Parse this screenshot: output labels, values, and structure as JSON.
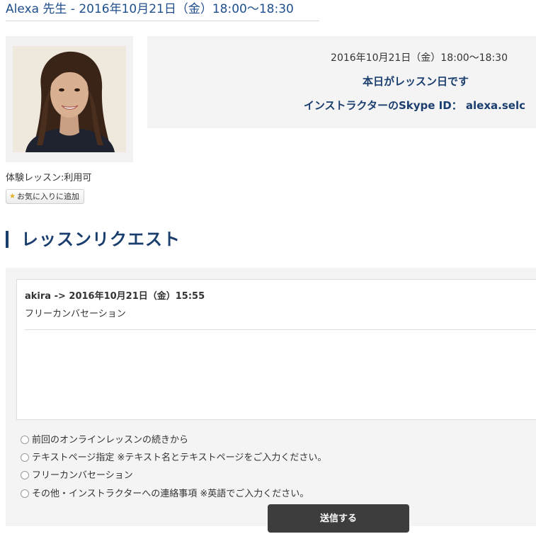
{
  "header": {
    "title": "Alexa 先生 - 2016年10月21日（金）18:00〜18:30"
  },
  "instructor": {
    "photo_alt": "instructor-photo",
    "trial_text": "体験レッスン:利用可",
    "favorite_label": "お気に入りに追加",
    "favorite_icon": "star-icon"
  },
  "lesson_info": {
    "datetime": "2016年10月21日（金）18:00〜18:30",
    "today_notice": "本日がレッスン日です",
    "skype_label": "インストラクターのSkype ID：",
    "skype_id": "alexa.selc"
  },
  "request": {
    "section_title": "レッスンリクエスト",
    "message": {
      "header": "akira -> 2016年10月21日（金）15:55",
      "body": "フリーカンバセーション"
    },
    "options": [
      "前回のオンラインレッスンの続きから",
      "テキストページ指定 ※テキスト名とテキストページをご入力ください。",
      "フリーカンバセーション",
      "その他・インストラクターへの連絡事項 ※英語でご入力ください。"
    ],
    "submit_label": "送信する"
  },
  "colors": {
    "accent": "#1a3e6e",
    "title": "#1e4f8c",
    "panel_bg": "#f4f4f4",
    "button_bg": "#3d3d3d"
  }
}
